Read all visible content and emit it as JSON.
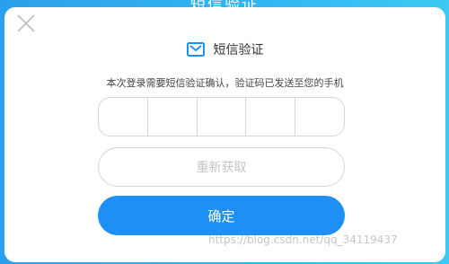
{
  "background_title": "短信验证",
  "dialog": {
    "close_icon": "close-icon",
    "title": "短信验证",
    "title_icon": "envelope-check-icon",
    "description": "本次登录需要短信验证确认，验证码已发送至您的手机",
    "code_cells": [
      "",
      "",
      "",
      "",
      ""
    ],
    "resend_label": "重新获取",
    "confirm_label": "确定"
  },
  "watermark": "https://blog.csdn.net/qq_34119437",
  "colors": {
    "accent": "#1e8ff5",
    "background_gradient_start": "#2aa0ec",
    "background_gradient_end": "#3cc9f4",
    "border": "#d6d6d6",
    "disabled_text": "#c4c4c4"
  }
}
